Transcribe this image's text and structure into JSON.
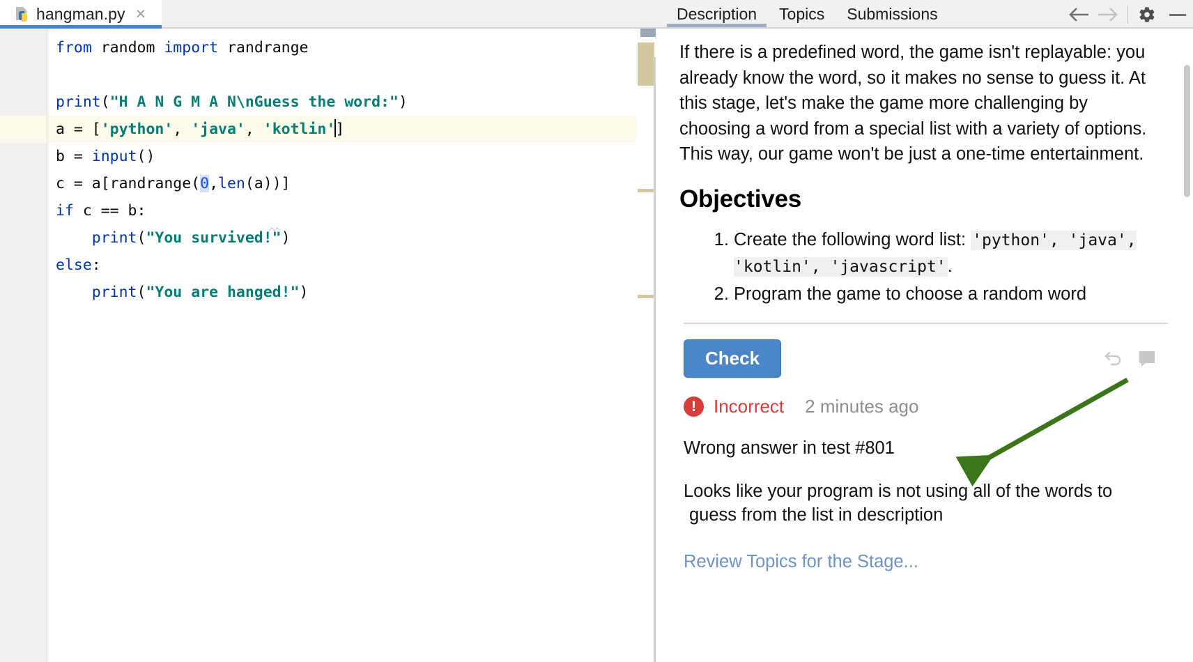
{
  "editor": {
    "tab": {
      "filename": "hangman.py",
      "close_label": "×",
      "icon": "python-file-icon"
    },
    "active_line": 4,
    "code_lines": [
      "from random import randrange",
      "",
      "print(\"H A N G M A N\\nGuess the word:\")",
      "a = ['python', 'java', 'kotlin']",
      "b = input()",
      "c = a[randrange(0,len(a))]",
      "if c == b:",
      "    print(\"You survived!\")",
      "else:",
      "    print(\"You are hanged!\")"
    ],
    "colors": {
      "keyword": "#0033b3",
      "string": "#067d74",
      "number": "#1750eb",
      "text": "#080808",
      "active_line_bg": "#fcfaeb",
      "gutter_bg": "#f0f0f0",
      "tab_underline": "#3e87d0",
      "marker": "#d3c89e"
    }
  },
  "task": {
    "tabs": [
      {
        "label": "Description",
        "active": true
      },
      {
        "label": "Topics",
        "active": false
      },
      {
        "label": "Submissions",
        "active": false
      }
    ],
    "toolbar": [
      {
        "name": "back-arrow-icon",
        "glyph": "←",
        "enabled": true
      },
      {
        "name": "forward-arrow-icon",
        "glyph": "→",
        "enabled": false
      },
      {
        "name": "gear-icon",
        "glyph": "⚙",
        "enabled": true
      },
      {
        "name": "minimize-icon",
        "glyph": "—",
        "enabled": true
      }
    ],
    "description": "If there is a predefined word, the game isn't replayable: you already know the word, so it makes no sense to guess it. At this stage, let's make the game more challenging by choosing a word from a special list with a variety of options. This way, our game won't be just a one-time entertainment.",
    "objectives_heading": "Objectives",
    "objectives": [
      {
        "text_before": "Create the following word list: ",
        "code": "'python', 'java', 'kotlin', 'javascript'",
        "text_after": "."
      },
      {
        "text_before": "Program the game to choose a random word",
        "code": "",
        "text_after": ""
      }
    ],
    "check_button": "Check",
    "reset_icon": "undo-icon",
    "comment_icon": "comment-icon",
    "status": {
      "badge_icon": "error-icon",
      "badge_glyph": "!",
      "label": "Incorrect",
      "label_color": "#d93a3a",
      "time": "2 minutes ago"
    },
    "feedback_title": "Wrong answer in test #801",
    "feedback_line1": "Looks like your program is not using all of the words to",
    "feedback_line2": "guess from the list in description",
    "review_link": "Review Topics for the Stage...",
    "accent_color": "#4a86c8"
  },
  "annotation": {
    "arrow_color": "#3b7519",
    "name": "green-pointer-arrow"
  }
}
